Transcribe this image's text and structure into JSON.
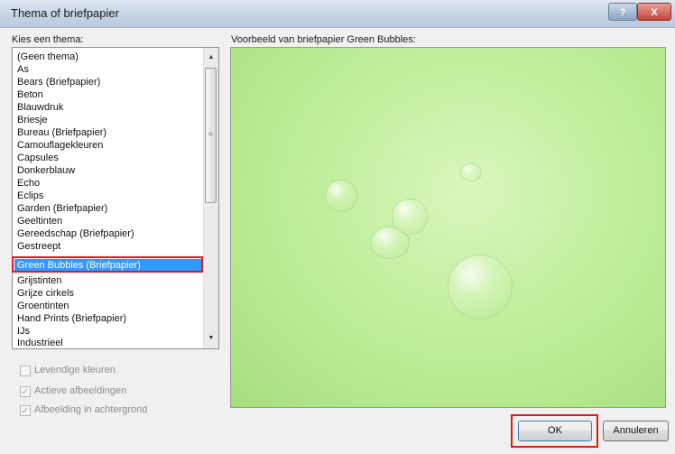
{
  "window": {
    "title": "Thema of briefpapier",
    "help_label": "?",
    "close_label": "X"
  },
  "left_panel": {
    "label": "Kies een thema:",
    "items": [
      "(Geen thema)",
      "As",
      "Bears (Briefpapier)",
      "Beton",
      "Blauwdruk",
      "Briesje",
      "Bureau (Briefpapier)",
      "Camouflagekleuren",
      "Capsules",
      "Donkerblauw",
      "Echo",
      "Eclips",
      "Garden (Briefpapier)",
      "Geeltinten",
      "Gereedschap (Briefpapier)",
      "Gestreept",
      "Green Bubbles (Briefpapier)",
      "Grijstinten",
      "Grijze cirkels",
      "Groentinten",
      "Hand Prints (Briefpapier)",
      "IJs",
      "Industrieel"
    ],
    "selected_index": 16
  },
  "preview": {
    "label": "Voorbeeld van briefpapier Green Bubbles:",
    "background_color": "#b8ea93"
  },
  "options": {
    "vivid_colors": {
      "label": "Levendige kleuren",
      "checked": false,
      "enabled": false
    },
    "active_images": {
      "label": "Actieve afbeeldingen",
      "checked": true,
      "enabled": false
    },
    "background_image": {
      "label": "Afbeelding in achtergrond",
      "checked": true,
      "enabled": false
    }
  },
  "buttons": {
    "ok": "OK",
    "cancel": "Annuleren"
  },
  "icons": {
    "scroll_up": "triangle-up",
    "scroll_down": "triangle-down",
    "check": "checkmark"
  }
}
